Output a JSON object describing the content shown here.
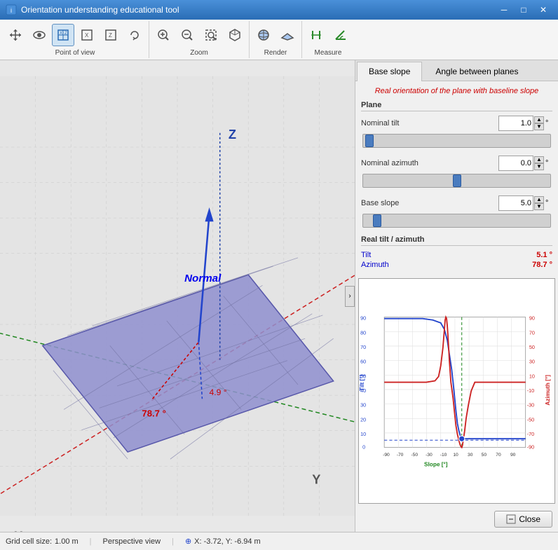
{
  "app": {
    "title": "Orientation understanding educational tool"
  },
  "titlebar": {
    "minimize_label": "─",
    "maximize_label": "□",
    "close_label": "✕"
  },
  "toolbar": {
    "groups": [
      {
        "name": "Point of view",
        "buttons": [
          {
            "icon": "✋",
            "label": "pan",
            "tooltip": "Pan"
          },
          {
            "icon": "👁",
            "label": "eye",
            "tooltip": "Eye"
          },
          {
            "icon": "⊞",
            "label": "top",
            "tooltip": "Top view",
            "active": true
          },
          {
            "icon": "⊟",
            "label": "front-x",
            "tooltip": "Front X"
          },
          {
            "icon": "⊠",
            "label": "front-z",
            "tooltip": "Front Z"
          },
          {
            "icon": "⟳",
            "label": "rotate",
            "tooltip": "Rotate"
          }
        ],
        "label": "Point of view"
      },
      {
        "name": "Zoom",
        "buttons": [
          {
            "icon": "⊕",
            "label": "zoom-in",
            "tooltip": "Zoom in"
          },
          {
            "icon": "⊖",
            "label": "zoom-out",
            "tooltip": "Zoom out"
          },
          {
            "icon": "⛶",
            "label": "zoom-fit",
            "tooltip": "Zoom fit"
          },
          {
            "icon": "◧",
            "label": "cube",
            "tooltip": "Cube"
          }
        ],
        "label": "Zoom"
      },
      {
        "name": "Render",
        "buttons": [
          {
            "icon": "⬡",
            "label": "sphere",
            "tooltip": "Sphere"
          },
          {
            "icon": "▭",
            "label": "plane",
            "tooltip": "Plane"
          }
        ],
        "label": "Render"
      },
      {
        "name": "Measure",
        "buttons": [
          {
            "icon": "↕",
            "label": "measure1",
            "tooltip": "Measure"
          },
          {
            "icon": "△",
            "label": "measure2",
            "tooltip": "Angle"
          }
        ],
        "label": "Measure"
      }
    ]
  },
  "tabs": [
    {
      "id": "base-slope",
      "label": "Base slope",
      "active": true
    },
    {
      "id": "angle-between-planes",
      "label": "Angle between planes",
      "active": false
    }
  ],
  "panel": {
    "info_text": "Real orientation of the plane with baseline slope",
    "plane_section": "Plane",
    "nominal_tilt_label": "Nominal tilt",
    "nominal_tilt_value": "1.0",
    "nominal_azimuth_label": "Nominal azimuth",
    "nominal_azimuth_value": "0.0",
    "base_slope_label": "Base slope",
    "base_slope_value": "5.0",
    "degree_symbol": "°",
    "real_tilt_section": "Real tilt / azimuth",
    "tilt_label": "Tilt",
    "tilt_value": "5.1 °",
    "azimuth_label": "Azimuth",
    "azimuth_value": "78.7 °"
  },
  "viewport": {
    "normal_label": "Normal",
    "azimuth_annotation": "78.7 °",
    "tilt_annotation": "4.9 °",
    "axis_x": "X",
    "axis_y": "Y",
    "axis_z": "Z"
  },
  "chart": {
    "x_axis_label": "Slope [°]",
    "y_left_label": "Tilt [°]",
    "y_right_label": "Azimuth [°]",
    "x_ticks": [
      "-90",
      "-70",
      "-50",
      "-30",
      "-10",
      "10",
      "30",
      "50",
      "70",
      "90"
    ],
    "y_ticks_left": [
      "0",
      "10",
      "20",
      "30",
      "40",
      "50",
      "60",
      "70",
      "80",
      "90"
    ],
    "y_ticks_right": [
      "-90",
      "-70",
      "-50",
      "-30",
      "-10",
      "10",
      "30",
      "50",
      "70",
      "90"
    ]
  },
  "status": {
    "grid_cell_size_label": "Grid cell size:",
    "grid_cell_size_value": "1.00 m",
    "view_type": "Perspective view",
    "crosshair_icon": "⊕",
    "coordinates": "X: -3.72, Y: -6.94 m"
  },
  "close_button_label": "Close"
}
